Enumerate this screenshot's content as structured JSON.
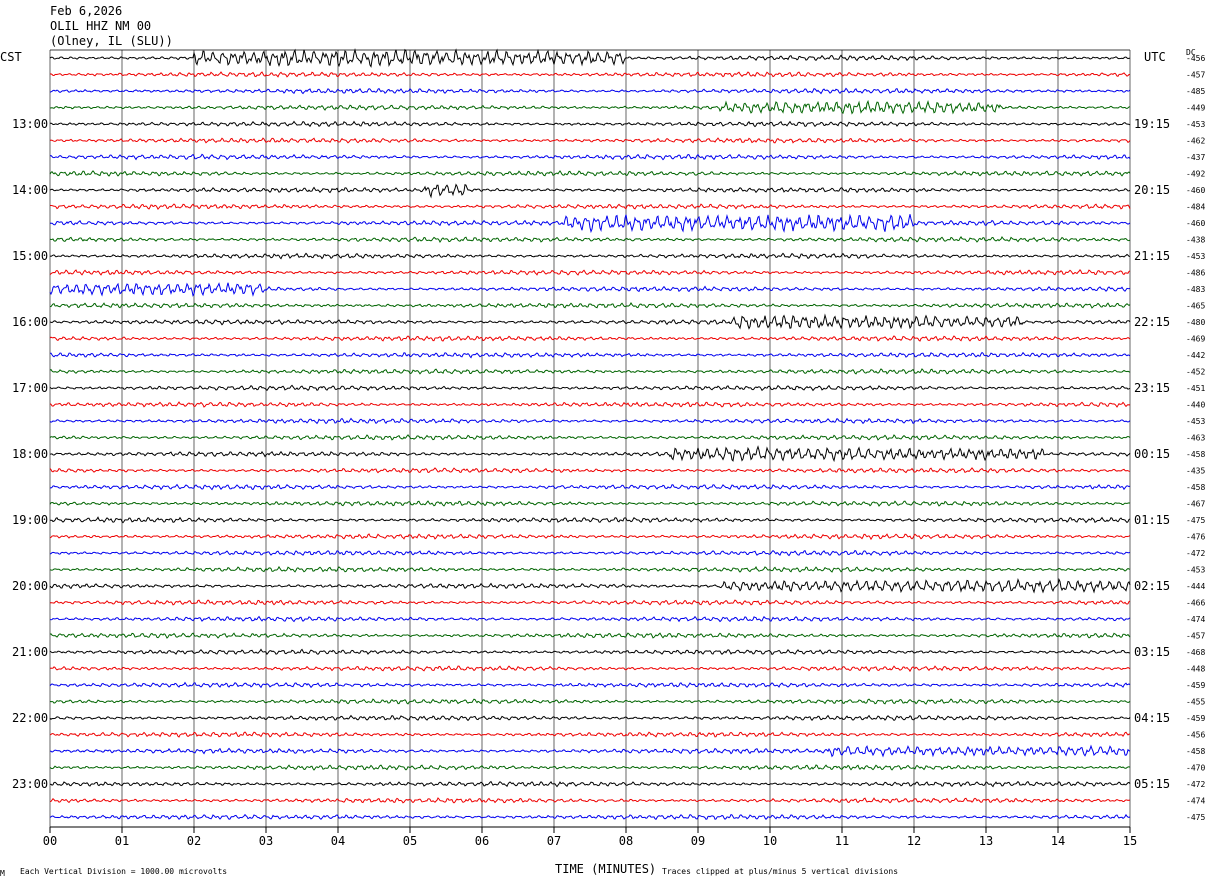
{
  "header": {
    "date": "Feb 6,2026",
    "station": "OLIL HHZ NM 00",
    "location": "(Olney, IL (SLU))"
  },
  "left_timezone": "CST",
  "right_timezone": "UTC",
  "dc_label": "DC",
  "footer": {
    "scale_note": "Each Vertical Division = 1000.00 microvolts",
    "xlabel": "TIME (MINUTES)",
    "clip_note": "Traces clipped at plus/minus 5 vertical divisions",
    "corner_mark": "M"
  },
  "colors": {
    "trace_cycle": [
      "#000000",
      "#ee0000",
      "#0000ee",
      "#006400"
    ],
    "grid": "#000000"
  },
  "chart_data": {
    "type": "line",
    "subtype": "helicorder",
    "xlabel": "TIME (MINUTES)",
    "xlim": [
      0,
      15
    ],
    "x_ticks": [
      "00",
      "01",
      "02",
      "03",
      "04",
      "05",
      "06",
      "07",
      "08",
      "09",
      "10",
      "11",
      "12",
      "13",
      "14",
      "15"
    ],
    "rows_per_hour": 4,
    "left_time_labels": [
      "13:00",
      "14:00",
      "15:00",
      "16:00",
      "17:00",
      "18:00",
      "19:00",
      "20:00",
      "21:00",
      "22:00",
      "23:00"
    ],
    "right_time_labels": [
      "19:15",
      "20:15",
      "21:15",
      "22:15",
      "23:15",
      "00:15",
      "01:15",
      "02:15",
      "03:15",
      "04:15",
      "05:15"
    ],
    "dc_offsets": [
      -456,
      -457,
      -485,
      -449,
      -453,
      -462,
      -437,
      -492,
      -460,
      -484,
      -460,
      -438,
      -453,
      -486,
      -483,
      -465,
      -480,
      -469,
      -442,
      -452,
      -451,
      -440,
      -453,
      -463,
      -458,
      -435,
      -458,
      -467,
      -475,
      -476,
      -472,
      -453,
      -444,
      -466,
      -474,
      -457,
      -468,
      -448,
      -459,
      -455,
      -459,
      -456,
      -458,
      -470,
      -472,
      -474,
      -475
    ],
    "bursts": [
      {
        "row": 0,
        "start_min": 2.0,
        "end_min": 8.0,
        "amp": 2.4
      },
      {
        "row": 3,
        "start_min": 9.3,
        "end_min": 13.2,
        "amp": 1.5
      },
      {
        "row": 8,
        "start_min": 5.2,
        "end_min": 5.8,
        "amp": 2.0
      },
      {
        "row": 10,
        "start_min": 7.1,
        "end_min": 12.0,
        "amp": 2.6
      },
      {
        "row": 14,
        "start_min": 0.0,
        "end_min": 3.0,
        "amp": 1.6
      },
      {
        "row": 16,
        "start_min": 9.5,
        "end_min": 13.5,
        "amp": 2.0
      },
      {
        "row": 24,
        "start_min": 8.6,
        "end_min": 13.8,
        "amp": 1.8
      },
      {
        "row": 32,
        "start_min": 9.3,
        "end_min": 15.0,
        "amp": 1.6
      },
      {
        "row": 42,
        "start_min": 10.8,
        "end_min": 15.0,
        "amp": 1.3
      }
    ]
  }
}
